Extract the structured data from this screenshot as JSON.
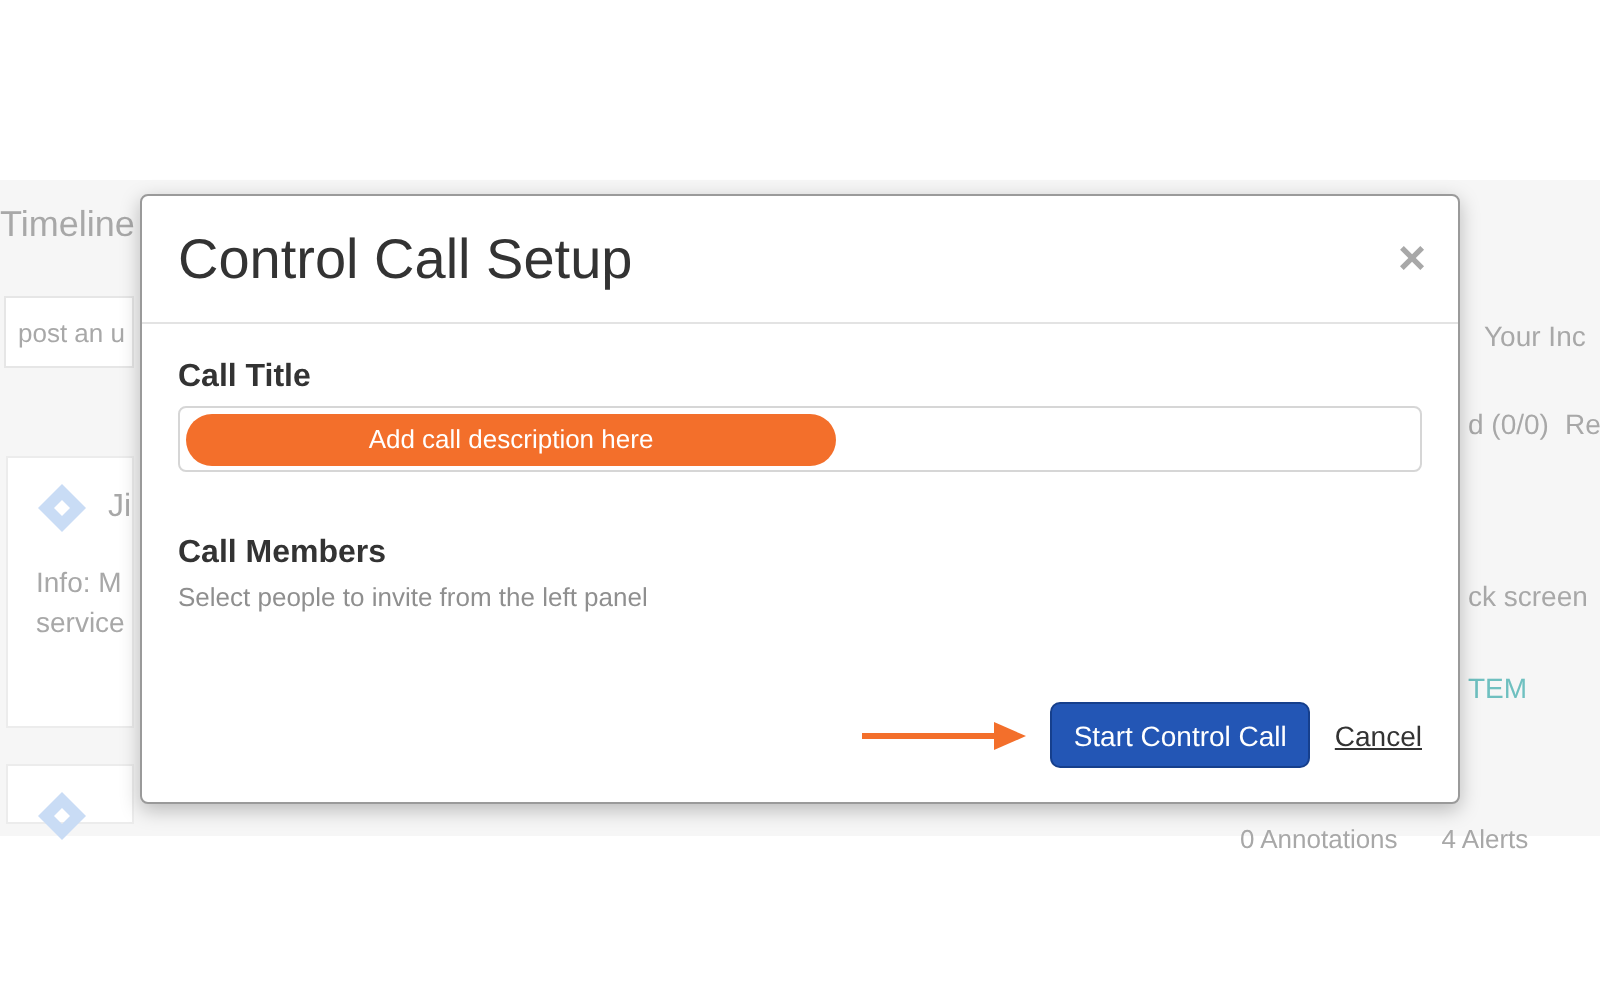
{
  "background": {
    "header": "Timeline",
    "search": {
      "placeholder": "post an u"
    },
    "cards": [
      {
        "kind": "post",
        "title": "Ji",
        "lines": [
          "Info: M",
          "service"
        ]
      },
      {
        "kind": "stub"
      }
    ],
    "right_tab": "Your Inc",
    "subtabs": [
      "d (0/0)",
      "Re"
    ],
    "snippet": "ck screen",
    "link": "TEM",
    "footer": [
      "0 Annotations",
      "4 Alerts"
    ]
  },
  "dialog": {
    "title": "Control Call Setup",
    "close": "×",
    "sections": [
      {
        "kind": "field",
        "label": "Call Title",
        "value": "Add call description here"
      },
      {
        "kind": "hint",
        "label": "Call Members",
        "hint": "Select people to invite from the left panel"
      }
    ],
    "primary": "Start Control Call",
    "cancel": "Cancel",
    "pointer_arrow": true
  }
}
